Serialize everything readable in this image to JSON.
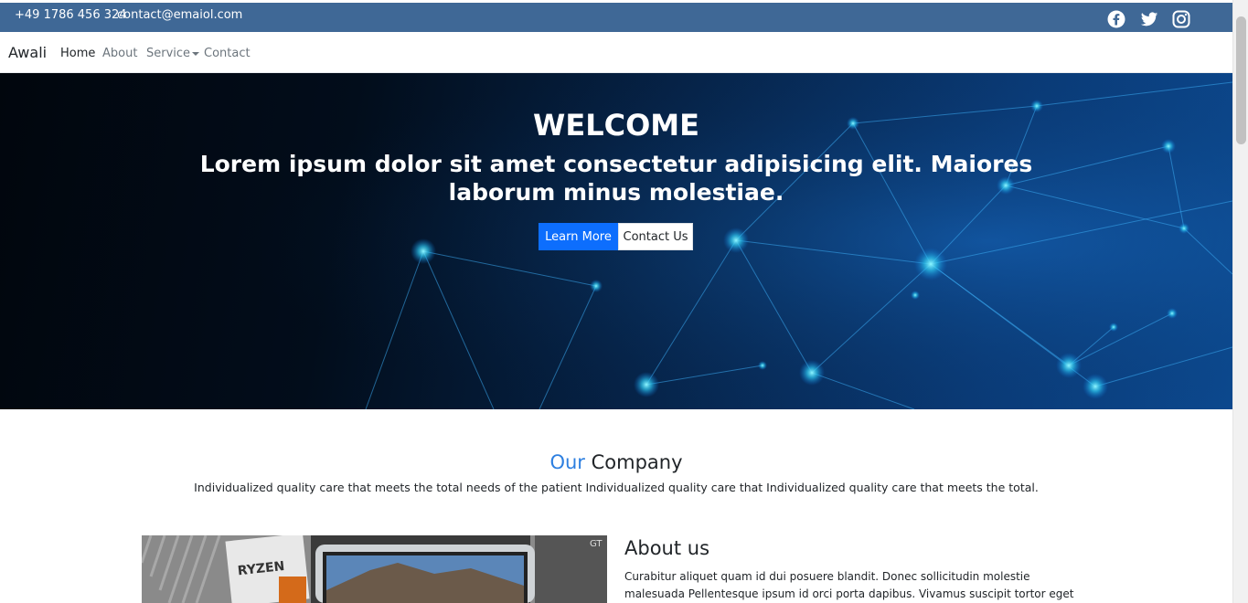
{
  "topbar": {
    "phone": "+49 1786 456 324",
    "email": "contact@emaiol.com",
    "social": [
      "facebook-icon",
      "twitter-icon",
      "instagram-icon"
    ],
    "color": "#3f6896"
  },
  "navbar": {
    "brand": "Awali",
    "links": [
      {
        "label": "Home",
        "active": true
      },
      {
        "label": "About"
      },
      {
        "label": "Service",
        "dropdown": true
      },
      {
        "label": "Contact"
      }
    ]
  },
  "hero": {
    "title": "WELCOME",
    "subtitle": "Lorem ipsum dolor sit amet consectetur adipisicing elit. Maiores laborum minus molestiae.",
    "learn_more": "Learn More",
    "contact_us": "Contact Us",
    "primary_color": "#0d6efd"
  },
  "company": {
    "title_accent": "Our",
    "title_rest": "Company",
    "description": "Individualized quality care that meets the total needs of the patient Individualized quality care that Individualized quality care that meets the total.",
    "accent_color": "#2d7fe0"
  },
  "about": {
    "title": "About us",
    "text": "Curabitur aliquet quam id dui posuere blandit. Donec sollicitudin molestie malesuada Pellentesque ipsum id orci porta dapibus. Vivamus suscipit tortor eget felis porttitor"
  }
}
